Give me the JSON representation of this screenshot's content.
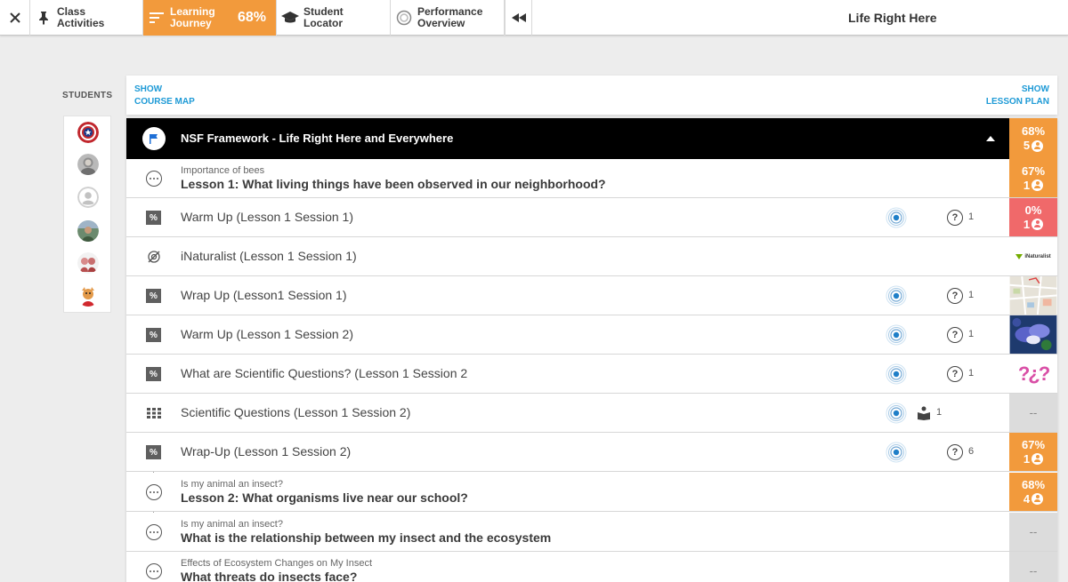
{
  "nav": {
    "class_activities": "Class\nActivities",
    "class_activities_l1": "Class",
    "class_activities_l2": "Activities",
    "journey_l1": "Learning",
    "journey_l2": "Journey",
    "journey_pct": "68%",
    "locator_l1": "Student",
    "locator_l2": "Locator",
    "perf_l1": "Performance",
    "perf_l2": "Overview",
    "title": "Life Right Here"
  },
  "students": {
    "label": "STUDENTS",
    "avatars": [
      "shield-avatar",
      "portrait-avatar",
      "default-avatar",
      "photo-avatar",
      "group-avatar",
      "character-avatar"
    ]
  },
  "header": {
    "show_course_map_l1": "SHOW",
    "show_course_map_l2": "COURSE MAP",
    "show_lesson_plan_l1": "SHOW",
    "show_lesson_plan_l2": "LESSON PLAN"
  },
  "unit": {
    "title": "NSF Framework - Life Right Here and Everywhere",
    "pct": "68%",
    "count": "5"
  },
  "rows": [
    {
      "kind": "lesson",
      "sub": "Importance of bees",
      "title": "Lesson 1: What living things have been observed in our neighborhood?",
      "pct": "67%",
      "count": "1",
      "score": "orange"
    },
    {
      "kind": "item",
      "icon": "%",
      "title": "Warm Up (Lesson 1 Session 1)",
      "q": "1",
      "pct": "0%",
      "count": "1",
      "score": "red"
    },
    {
      "kind": "item",
      "icon": "no-target",
      "title": "iNaturalist (Lesson 1 Session 1)",
      "thumb": "iNaturalist"
    },
    {
      "kind": "item",
      "icon": "%",
      "title": "Wrap Up (Lesson1 Session 1)",
      "q": "1",
      "thumb": "map"
    },
    {
      "kind": "item",
      "icon": "%",
      "title": "Warm Up (Lesson 1 Session 2)",
      "q": "1",
      "thumb": "flower"
    },
    {
      "kind": "item",
      "icon": "%",
      "title": "What are Scientific Questions? (Lesson 1 Session 2",
      "q": "1",
      "thumb": "questions"
    },
    {
      "kind": "item",
      "icon": "grid",
      "title": "Scientific Questions (Lesson 1 Session 2)",
      "book": "1",
      "dash": "--"
    },
    {
      "kind": "item",
      "icon": "%",
      "title": "Wrap-Up (Lesson 1 Session 2)",
      "q": "6",
      "pct": "67%",
      "count": "1",
      "score": "orange"
    },
    {
      "kind": "lesson",
      "sub": "Is my animal an insect?",
      "title": "Lesson 2: What organisms live near our school?",
      "pct": "68%",
      "count": "4",
      "score": "orange"
    },
    {
      "kind": "lesson",
      "sub": "Is my animal an insect?",
      "title": "What is the relationship between my insect and the ecosystem",
      "dash": "--"
    },
    {
      "kind": "lesson",
      "sub": "Effects of Ecosystem Changes on My Insect",
      "title": "What threats do insects face?",
      "dash": "--"
    }
  ],
  "thumb_texts": {
    "inaturalist": "iNaturalist",
    "questions": "?¿?"
  },
  "colors": {
    "accent_orange": "#f29a3c",
    "accent_red": "#f0696a",
    "link_blue": "#1e9ad6"
  }
}
